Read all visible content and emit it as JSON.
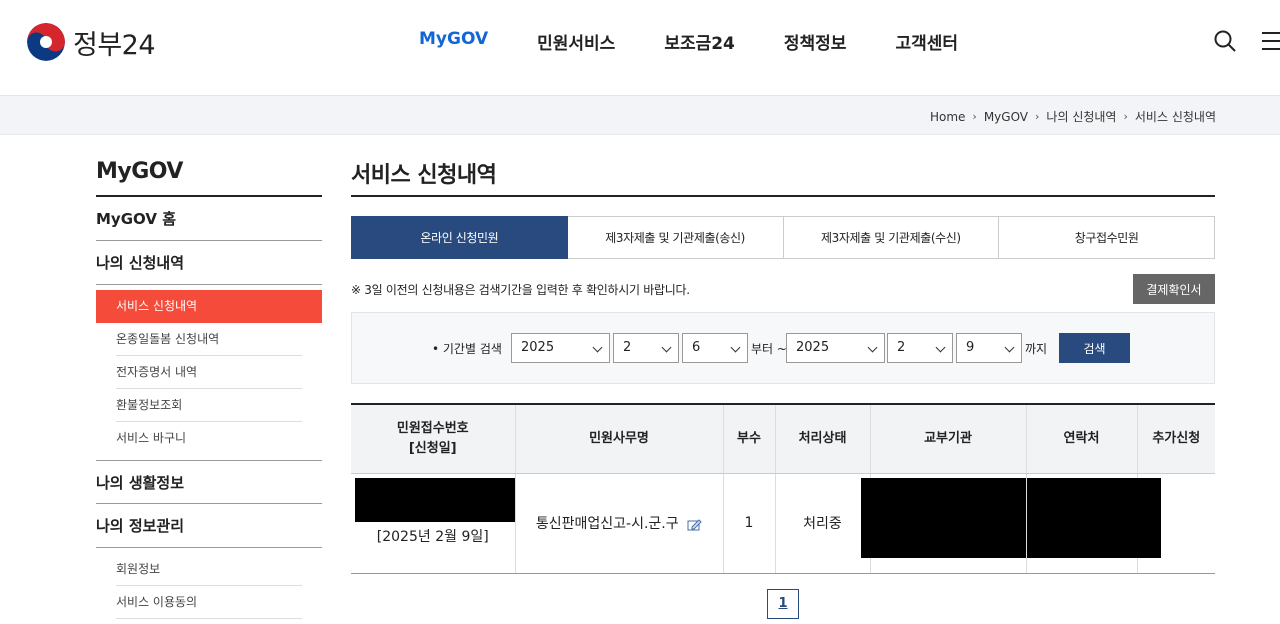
{
  "header": {
    "logo_text": "정부24",
    "nav": [
      "MyGOV",
      "민원서비스",
      "보조금24",
      "정책정보",
      "고객센터"
    ],
    "active_nav": "MyGOV"
  },
  "breadcrumb": [
    "Home",
    "MyGOV",
    "나의 신청내역",
    "서비스 신청내역"
  ],
  "sidebar": {
    "title": "MyGOV",
    "home": "MyGOV 홈",
    "section1": {
      "title": "나의 신청내역",
      "items": [
        "서비스 신청내역",
        "온종일돌봄 신청내역",
        "전자증명서 내역",
        "환불정보조회",
        "서비스 바구니"
      ],
      "active": "서비스 신청내역"
    },
    "section2": {
      "title": "나의 생활정보"
    },
    "section3": {
      "title": "나의 정보관리",
      "items": [
        "회원정보",
        "서비스 이용동의"
      ]
    }
  },
  "main": {
    "title": "서비스 신청내역",
    "tabs": [
      "온라인 신청민원",
      "제3자제출 및 기관제출(송신)",
      "제3자제출 및 기관제출(수신)",
      "창구접수민원"
    ],
    "active_tab": "온라인 신청민원",
    "notice": "※ 3일 이전의 신청내용은 검색기간을 입력한 후 확인하시기 바랍니다.",
    "confirm_button": "결제확인서",
    "search": {
      "label": "• 기간별 검색",
      "from": {
        "year": "2025",
        "month": "2",
        "day": "6"
      },
      "from_suffix": "부터 ~",
      "to": {
        "year": "2025",
        "month": "2",
        "day": "9"
      },
      "to_suffix": "까지",
      "button": "검색"
    },
    "table": {
      "headers": [
        "민원접수번호\n[신청일]",
        "민원사무명",
        "부수",
        "처리상태",
        "교부기관",
        "연락처",
        "추가신청"
      ],
      "header_no_line1": "민원접수번호",
      "header_no_line2": "[신청일]",
      "rows": [
        {
          "date": "[2025년 2월 9일]",
          "service": "통신판매업신고-시.군.구",
          "copies": "1",
          "status": "처리중"
        }
      ]
    },
    "pagination": {
      "current": "1"
    }
  },
  "colors": {
    "accent_blue": "#1266d6",
    "navy": "#284a7e",
    "active_side": "#f44b3a"
  }
}
